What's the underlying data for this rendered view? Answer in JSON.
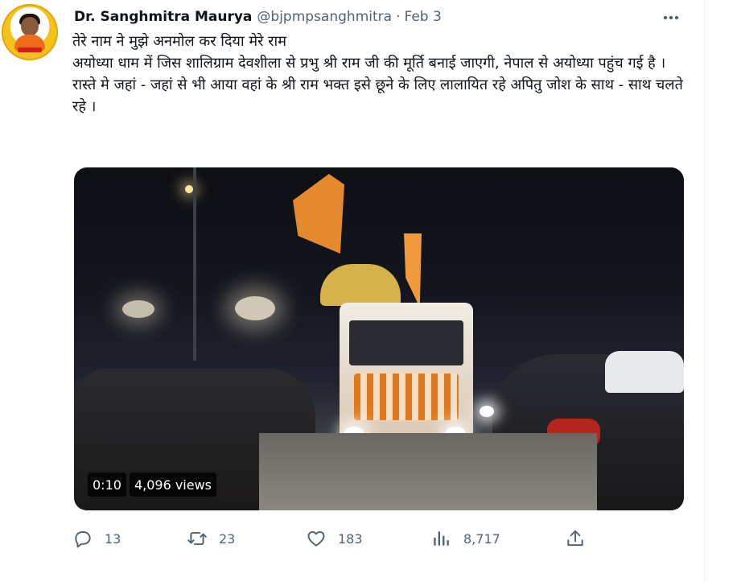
{
  "tweet": {
    "author_name": "Dr. Sanghmitra Maurya",
    "handle": "@bjpmpsanghmitra",
    "separator": "·",
    "date": "Feb 3",
    "text": "तेरे नाम ने मुझे अनमोल कर दिया मेरे राम\nअयोध्या धाम में जिस शालिग्राम देवशीला से प्रभु श्री राम जी की मूर्ति बनाई जाएगी, नेपाल से अयोध्या पहुंच गई है ।\nरास्ते मे जहां - जहां से भी आया वहां के श्री राम भक्त इसे छूने के लिए लालायित रहे अपितु जोश के साथ - साथ चलते रहे ।",
    "icons": {
      "more": "more-icon",
      "reply": "reply-icon",
      "retweet": "retweet-icon",
      "like": "like-icon",
      "views": "views-icon",
      "share": "share-icon"
    }
  },
  "video": {
    "timestamp": "0:10",
    "views": "4,096 views"
  },
  "actions": {
    "replies": "13",
    "retweets": "23",
    "likes": "183",
    "views": "8,717"
  },
  "colors": {
    "text": "#0f1419",
    "muted": "#536471",
    "avatar_ring": "#f4c21a"
  }
}
